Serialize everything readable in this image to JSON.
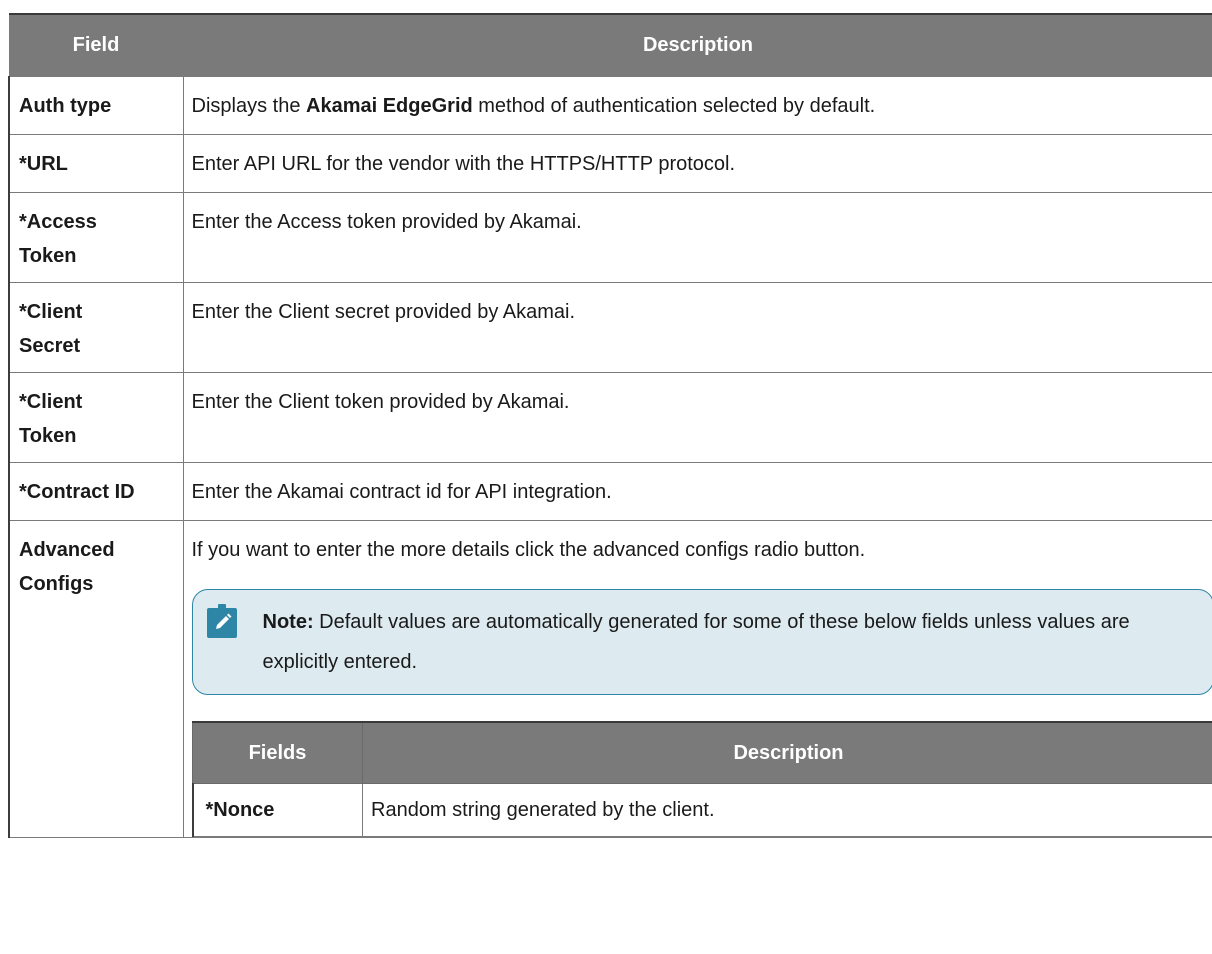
{
  "table": {
    "headers": [
      "Field",
      "Description"
    ],
    "rows": [
      {
        "field": "Auth type",
        "desc_prefix": "Displays the ",
        "desc_bold": "Akamai EdgeGrid",
        "desc_suffix": " method of authentication selected by default."
      },
      {
        "field": "*URL",
        "desc": "Enter API URL for the vendor with the HTTPS/HTTP protocol."
      },
      {
        "field_line1": "*Access",
        "field_line2": "Token",
        "desc": "Enter the Access token provided by Akamai."
      },
      {
        "field_line1": "*Client",
        "field_line2": "Secret",
        "desc": "Enter the Client secret provided by Akamai."
      },
      {
        "field_line1": "*Client",
        "field_line2": "Token",
        "desc": "Enter the Client token provided by Akamai."
      },
      {
        "field": "*Contract ID",
        "desc": "Enter the Akamai contract id for API integration."
      },
      {
        "field_line1": "Advanced",
        "field_line2": "Configs",
        "desc": "If you want to enter the more details click the advanced configs radio button."
      }
    ]
  },
  "note": {
    "icon": "pencil-note-icon",
    "label": "Note:",
    "text": " Default values are automatically generated for some of these below fields unless values are explicitly entered."
  },
  "inner_table": {
    "headers": [
      "Fields",
      "Description"
    ],
    "rows": [
      {
        "field": "*Nonce",
        "desc": "Random string generated by the client."
      }
    ]
  },
  "colors": {
    "header_bg": "#7a7a7a",
    "note_border": "#2d86a6",
    "note_bg": "#ddeaf0"
  }
}
